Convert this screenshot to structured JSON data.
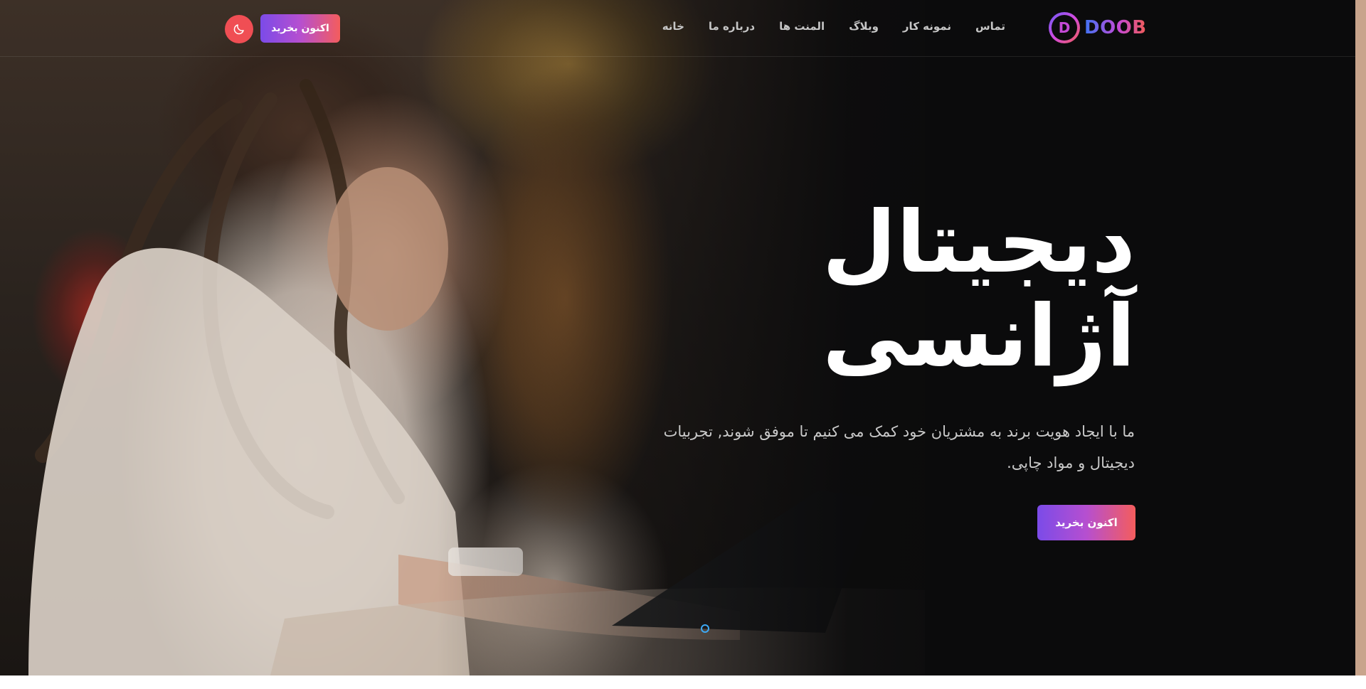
{
  "header": {
    "logo_text": "DOOB",
    "logo_letter": "D",
    "nav": [
      {
        "label": "خانه"
      },
      {
        "label": "درباره ما"
      },
      {
        "label": "المنت ها"
      },
      {
        "label": "وبلاگ"
      },
      {
        "label": "نمونه کار"
      },
      {
        "label": "تماس"
      }
    ],
    "buy_button_label": "اکنون بخرید",
    "theme_toggle_icon": "moon-icon"
  },
  "hero": {
    "title_line_1": "دیجیتال",
    "title_line_2": "آژانسی",
    "description": "ما با ایجاد هویت برند به مشتریان خود کمک می کنیم تا موفق شوند, تجربیات دیجیتال و مواد چاپی.",
    "buy_button_label": "اکنون بخرید",
    "image_icon": "hero-photo-woman-laptop"
  },
  "colors": {
    "background": "#0b0b0c",
    "accent_start": "#7b4be8",
    "accent_end": "#f45d5d",
    "toggle": "#f04e54",
    "logo_blue": "#3f74f5",
    "slider_dot": "#3da9f5"
  }
}
